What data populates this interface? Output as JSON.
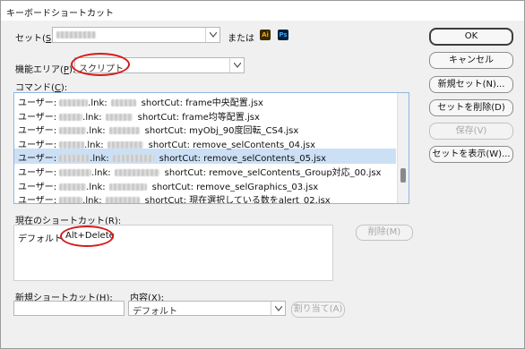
{
  "window": {
    "title": "キーボードショートカット"
  },
  "set": {
    "label_prefix": "セット(",
    "label_key": "S",
    "label_suffix": "):",
    "or_label": "または",
    "ai_badge": "Ai",
    "ps_badge": "Ps"
  },
  "area": {
    "label_prefix": "機能エリア(",
    "label_key": "P",
    "label_suffix": "):",
    "value": "スクリプト"
  },
  "commands": {
    "label_prefix": "コマンド(",
    "label_key": "C",
    "label_suffix": "):",
    "items": [
      {
        "user": "ユーザー:",
        "ext": ".lnk:",
        "cmd": "shortCut: frame中央配置.jsx",
        "selected": false
      },
      {
        "user": "ユーザー:",
        "ext": ".lnk:",
        "cmd": "shortCut: frame均等配置.jsx",
        "selected": false
      },
      {
        "user": "ユーザー:",
        "ext": ".lnk:",
        "cmd": "shortCut: myObj_90度回転_CS4.jsx",
        "selected": false
      },
      {
        "user": "ユーザー:",
        "ext": ".lnk:",
        "cmd": "shortCut: remove_selContents_04.jsx",
        "selected": false
      },
      {
        "user": "ユーザー:",
        "ext": ".lnk:",
        "cmd": "shortCut: remove_selContents_05.jsx",
        "selected": true
      },
      {
        "user": "ユーザー:",
        "ext": ".lnk:",
        "cmd": "shortCut: remove_selContents_Group対応_00.jsx",
        "selected": false
      },
      {
        "user": "ユーザー:",
        "ext": ".lnk:",
        "cmd": "shortCut: remove_selGraphics_03.jsx",
        "selected": false
      },
      {
        "user": "ユーザー:",
        "ext": ".lnk:",
        "cmd": "shortCut: 現在選択している数をalert_02.jsx",
        "selected": false
      }
    ]
  },
  "current": {
    "label_prefix": "現在のショートカット(",
    "label_key": "R",
    "label_suffix": "):",
    "context": "デフォルト",
    "shortcut": "Alt+Delete",
    "remove_label": "削除(M)"
  },
  "new_shortcut": {
    "label_prefix": "新規ショートカット(",
    "label_key": "H",
    "label_suffix": "):",
    "value": ""
  },
  "content": {
    "label_prefix": "内容(",
    "label_key": "X",
    "label_suffix": "):",
    "value": "デフォルト",
    "assign_label": "割り当て(A)"
  },
  "buttons": {
    "ok": "OK",
    "cancel": "キャンセル",
    "new_set": "新規セット(N)...",
    "delete_set": "セットを削除(D)",
    "save": "保存(V)",
    "show_set": "セットを表示(W)..."
  },
  "colors": {
    "highlight_ring": "#d41b1b",
    "selection": "#cce0f5",
    "ai_badge": "#3a2a00",
    "ps_badge": "#001e36"
  }
}
